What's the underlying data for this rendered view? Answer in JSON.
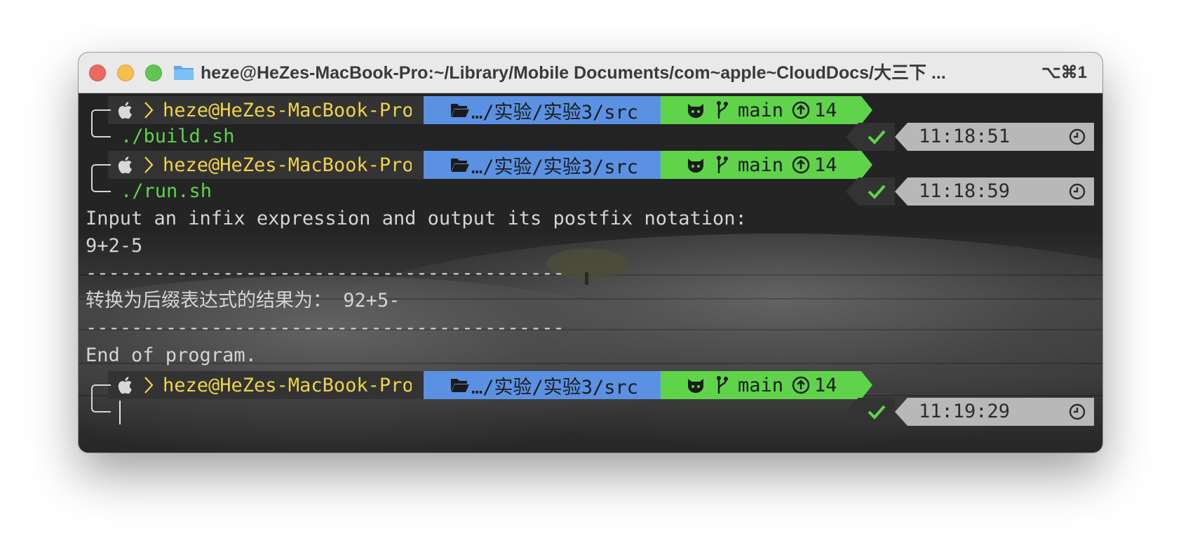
{
  "window": {
    "title": "heze@HeZes-MacBook-Pro:~/Library/Mobile Documents/com~apple~CloudDocs/大三下 ...",
    "shortcut": "⌥⌘1"
  },
  "prompt": {
    "host": "heze@HeZes-MacBook-Pro",
    "path": "…/实验/实验3/src",
    "branch": "main",
    "ahead": "14"
  },
  "colors": {
    "host_segment": "#333333",
    "host_text": "#f0d34a",
    "path_segment": "#5a91e3",
    "git_segment": "#5fd44a",
    "command_text": "#5fd44a",
    "time_segment": "#b8b8b8"
  },
  "icons": {
    "apple": "apple-icon",
    "chevron": "chevron-right-icon",
    "folder": "folder-open-icon",
    "github": "github-icon",
    "branch": "git-branch-icon",
    "ahead": "arrow-up-circle-icon",
    "check": "check-icon",
    "clock": "clock-icon"
  },
  "session": {
    "cmd1": "./build.sh",
    "time1": "11:18:51",
    "cmd2": "./run.sh",
    "time2": "11:18:59",
    "out1": "Input an infix expression and output its postfix notation:",
    "out2": "9+2-5",
    "sep1": "------------------------------------------",
    "out3": "转换为后缀表达式的结果为： 92+5-",
    "sep2": "------------------------------------------",
    "out4": "End of program.",
    "time3": "11:19:29"
  }
}
